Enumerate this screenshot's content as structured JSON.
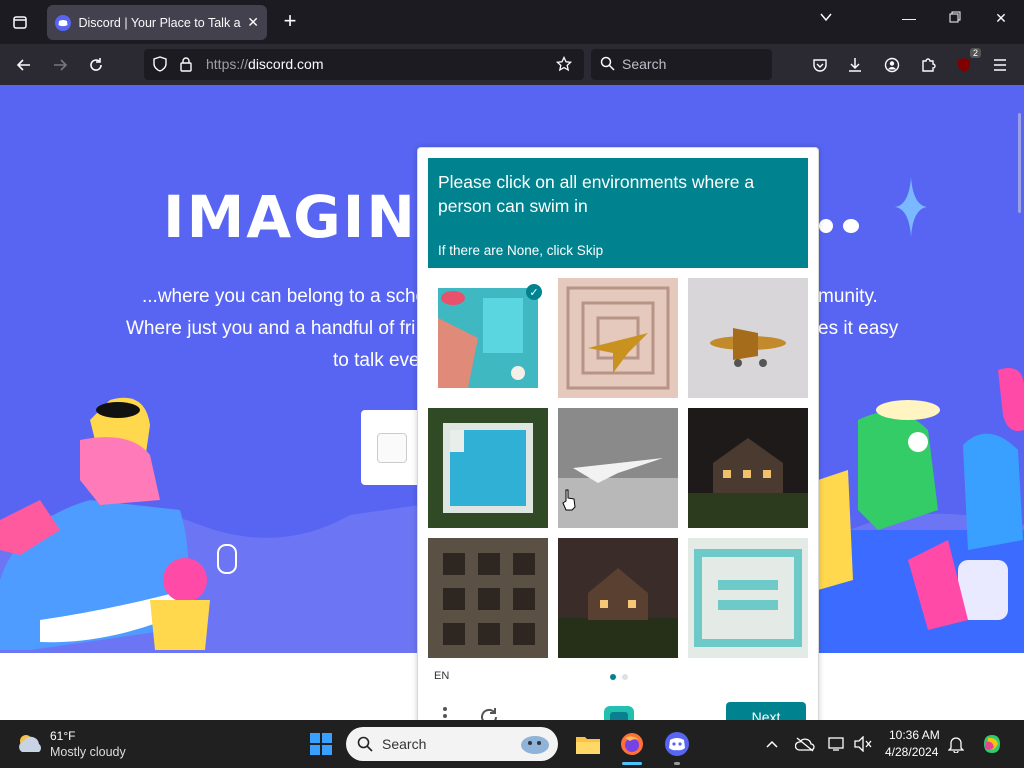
{
  "browser": {
    "tab_title": "Discord | Your Place to Talk and",
    "url_protocol": "https://",
    "url_host": "discord.com",
    "search_placeholder": "Search",
    "extension_badge": "2"
  },
  "page": {
    "hero_title": "IMAGIN",
    "hero_line1_left": "...where you can belong to a scho",
    "hero_line1_right": "munity.",
    "hero_line2_left": "Where just you and a handful of fri",
    "hero_line2_right": "es it easy",
    "hero_line3_left": "to talk eve"
  },
  "captcha": {
    "prompt": "Please click on all environments where a person can swim in",
    "subprompt": "If there are None, click Skip",
    "language": "EN",
    "next_label": "Next",
    "tiles": [
      {
        "name": "pool-top-view",
        "selected": true
      },
      {
        "name": "plane-pattern",
        "selected": false
      },
      {
        "name": "toy-airplane",
        "selected": false
      },
      {
        "name": "swimming-pool",
        "selected": false
      },
      {
        "name": "jet-in-clouds",
        "selected": false
      },
      {
        "name": "house-at-night",
        "selected": false
      },
      {
        "name": "table-grid",
        "selected": false
      },
      {
        "name": "house-at-dusk",
        "selected": false
      },
      {
        "name": "pool-illustration",
        "selected": false
      }
    ]
  },
  "taskbar": {
    "weather_temp": "61°F",
    "weather_desc": "Mostly cloudy",
    "search_placeholder": "Search",
    "time": "10:36 AM",
    "date": "4/28/2024"
  },
  "colors": {
    "discord_blurple": "#5865f2",
    "captcha_teal": "#00838f"
  }
}
